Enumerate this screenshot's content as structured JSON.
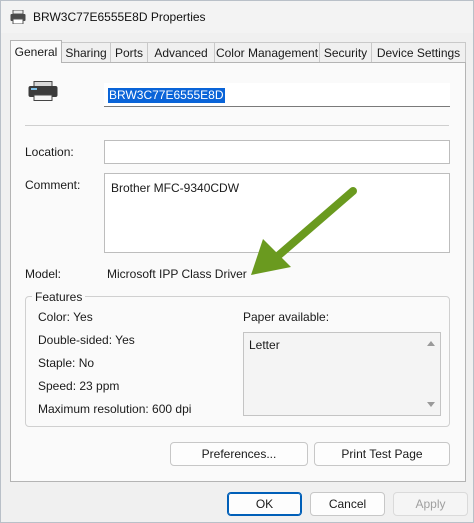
{
  "window": {
    "title": "BRW3C77E6555E8D Properties"
  },
  "tabs": [
    {
      "label": "General"
    },
    {
      "label": "Sharing"
    },
    {
      "label": "Ports"
    },
    {
      "label": "Advanced"
    },
    {
      "label": "Color Management"
    },
    {
      "label": "Security"
    },
    {
      "label": "Device Settings"
    }
  ],
  "general": {
    "printer_name": "BRW3C77E6555E8D",
    "location_label": "Location:",
    "location_value": "",
    "comment_label": "Comment:",
    "comment_value": "Brother MFC-9340CDW",
    "model_label": "Model:",
    "model_value": "Microsoft IPP Class Driver"
  },
  "features": {
    "title": "Features",
    "color": "Color: Yes",
    "double_sided": "Double-sided: Yes",
    "staple": "Staple: No",
    "speed": "Speed: 23 ppm",
    "max_resolution": "Maximum resolution: 600 dpi",
    "paper_label": "Paper available:",
    "paper_options": [
      "Letter"
    ]
  },
  "buttons": {
    "preferences": "Preferences...",
    "print_test": "Print Test Page",
    "ok": "OK",
    "cancel": "Cancel",
    "apply": "Apply"
  },
  "colors": {
    "selection": "#0a64d8",
    "annotation_arrow": "#6a9a1f",
    "ok_border": "#005fb8"
  },
  "icons": {
    "title_icon": "printer-icon",
    "printer_icon": "printer-icon",
    "scroll_up": "arrow-up-icon",
    "scroll_down": "arrow-down-icon",
    "annotation": "green-arrow"
  }
}
